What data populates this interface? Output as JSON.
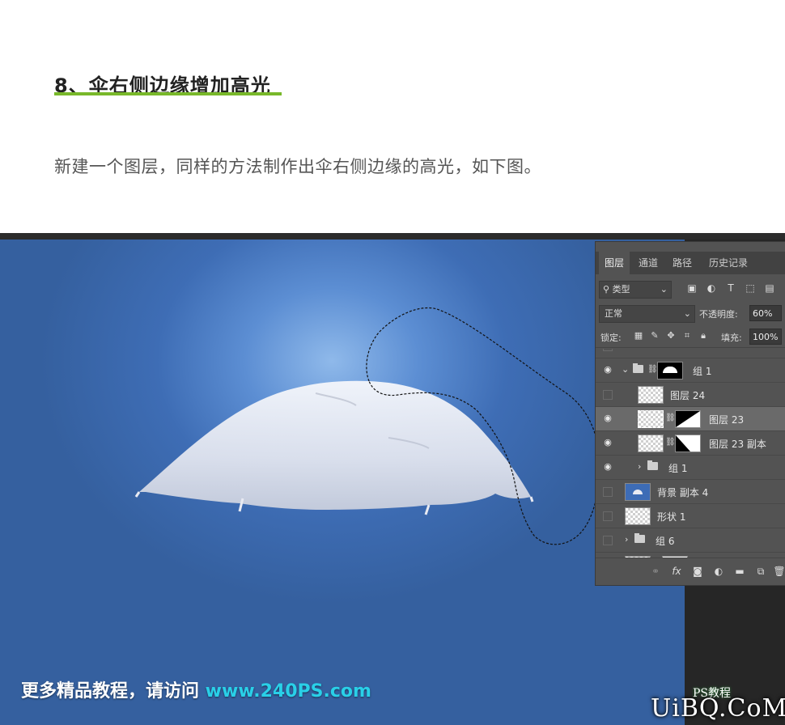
{
  "article": {
    "step_title": "8、伞右侧边缘增加高光",
    "description": "新建一个图层，同样的方法制作出伞右侧边缘的高光，如下图。",
    "accent_color": "#78b82a"
  },
  "panel": {
    "tabs": [
      {
        "label": "图层",
        "active": true
      },
      {
        "label": "通道",
        "active": false
      },
      {
        "label": "路径",
        "active": false
      },
      {
        "label": "历史记录",
        "active": false
      }
    ],
    "filter_label": "类型",
    "blend_mode": "正常",
    "opacity_label": "不透明度:",
    "opacity_value": "60%",
    "lock_label": "锁定:",
    "fill_label": "填充:",
    "fill_value": "100%",
    "layers": [
      {
        "name": "组 1",
        "type": "group-open",
        "visible": true
      },
      {
        "name": "图层 24",
        "type": "layer",
        "visible": false
      },
      {
        "name": "图层 23",
        "type": "layer-mask",
        "visible": true,
        "selected": true
      },
      {
        "name": "图层 23 副本",
        "type": "layer-mask",
        "visible": true
      },
      {
        "name": "组 1",
        "type": "group-closed",
        "visible": true
      },
      {
        "name": "背景 副本 4",
        "type": "layer",
        "visible": false
      },
      {
        "name": "形状 1",
        "type": "shape",
        "visible": false
      },
      {
        "name": "组 6",
        "type": "group-closed",
        "visible": false
      }
    ]
  },
  "watermark": {
    "prefix": "更多精品教程，请访问 ",
    "url": "www.240PS.com"
  },
  "logo": {
    "main": "UiBQ.CoM",
    "small": "PS教程"
  }
}
